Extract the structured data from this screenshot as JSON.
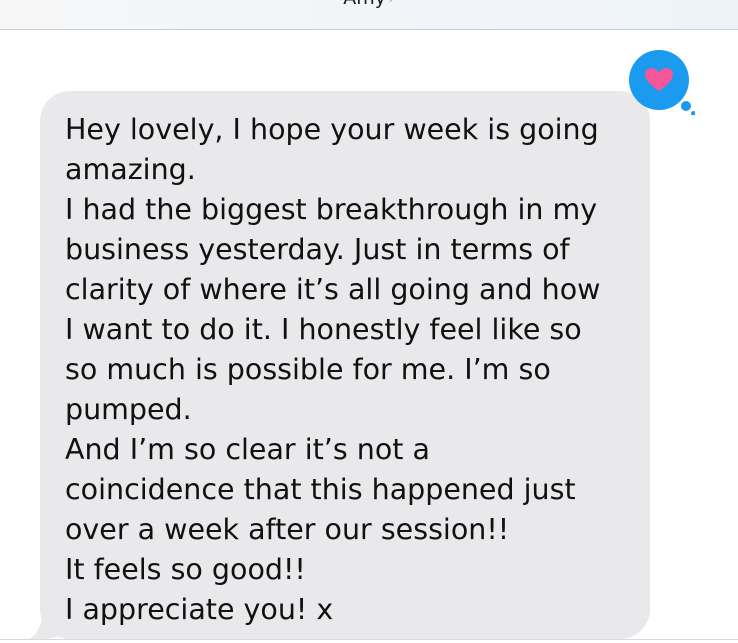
{
  "header": {
    "contact_name": "Amy",
    "chevron": "›"
  },
  "message": {
    "direction": "incoming",
    "lines": [
      "Hey lovely, I hope your week is going",
      "amazing.",
      "I had the biggest breakthrough in my",
      "business yesterday. Just in terms of",
      "clarity of where it’s all going and how",
      "I want to do it. I honestly feel like so",
      "so much is possible for me. I’m so",
      "pumped.",
      "And I’m so clear it’s not a",
      "coincidence that this happened just",
      "over a week after our session!!",
      "It feels so good!!",
      "I appreciate you! x"
    ],
    "bubble_color": "#e9e9eb",
    "text_color": "#111111"
  },
  "tapback": {
    "icon": "heart-icon",
    "bubble_color": "#1a9bf0",
    "heart_color": "#f5569a"
  }
}
